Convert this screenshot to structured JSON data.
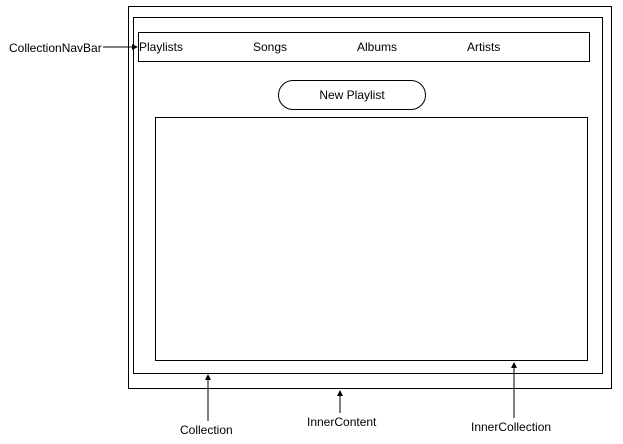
{
  "nav": {
    "items": [
      {
        "label": "Playlists"
      },
      {
        "label": "Songs"
      },
      {
        "label": "Albums"
      },
      {
        "label": "Artists"
      }
    ]
  },
  "button": {
    "new_playlist_label": "New Playlist"
  },
  "annotations": {
    "navbar": "CollectionNavBar",
    "collection": "Collection",
    "inner_content": "InnerContent",
    "inner_collection": "InnerCollection"
  }
}
